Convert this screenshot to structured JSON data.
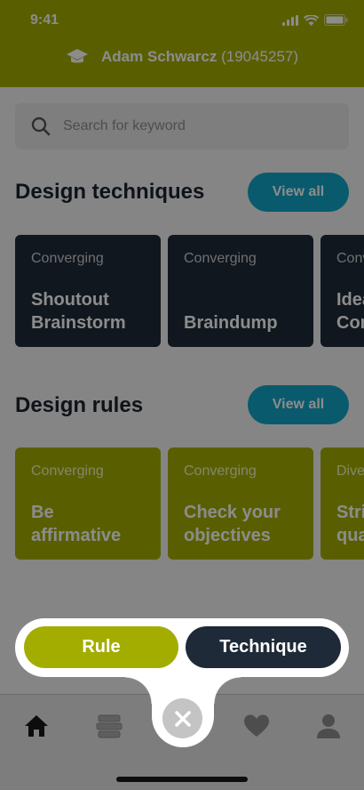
{
  "status": {
    "time": "9:41"
  },
  "user": {
    "name": "Adam Schwarcz",
    "id": "(19045257)"
  },
  "search": {
    "placeholder": "Search for keyword"
  },
  "techniques": {
    "title": "Design techniques",
    "view_all": "View all",
    "cards": [
      {
        "category": "Converging",
        "title": "Shoutout\nBrainstorm"
      },
      {
        "category": "Converging",
        "title": "Braindump"
      },
      {
        "category": "Converging",
        "title": "Idea\nCompass"
      }
    ]
  },
  "rules": {
    "title": "Design rules",
    "view_all": "View all",
    "cards": [
      {
        "category": "Converging",
        "title": "Be\naffirmative"
      },
      {
        "category": "Converging",
        "title": "Check your\nobjectives"
      },
      {
        "category": "Diverging",
        "title": "Strive for\nquantity"
      }
    ]
  },
  "popup": {
    "rule_label": "Rule",
    "technique_label": "Technique"
  },
  "tabs": [
    {
      "icon": "home-icon"
    },
    {
      "icon": "books-icon"
    },
    {
      "icon": "add-icon"
    },
    {
      "icon": "heart-icon"
    },
    {
      "icon": "profile-icon"
    }
  ],
  "colors": {
    "brand_olive": "#a3ad00",
    "navy": "#1f2a38",
    "accent_cyan": "#13a5c6"
  }
}
